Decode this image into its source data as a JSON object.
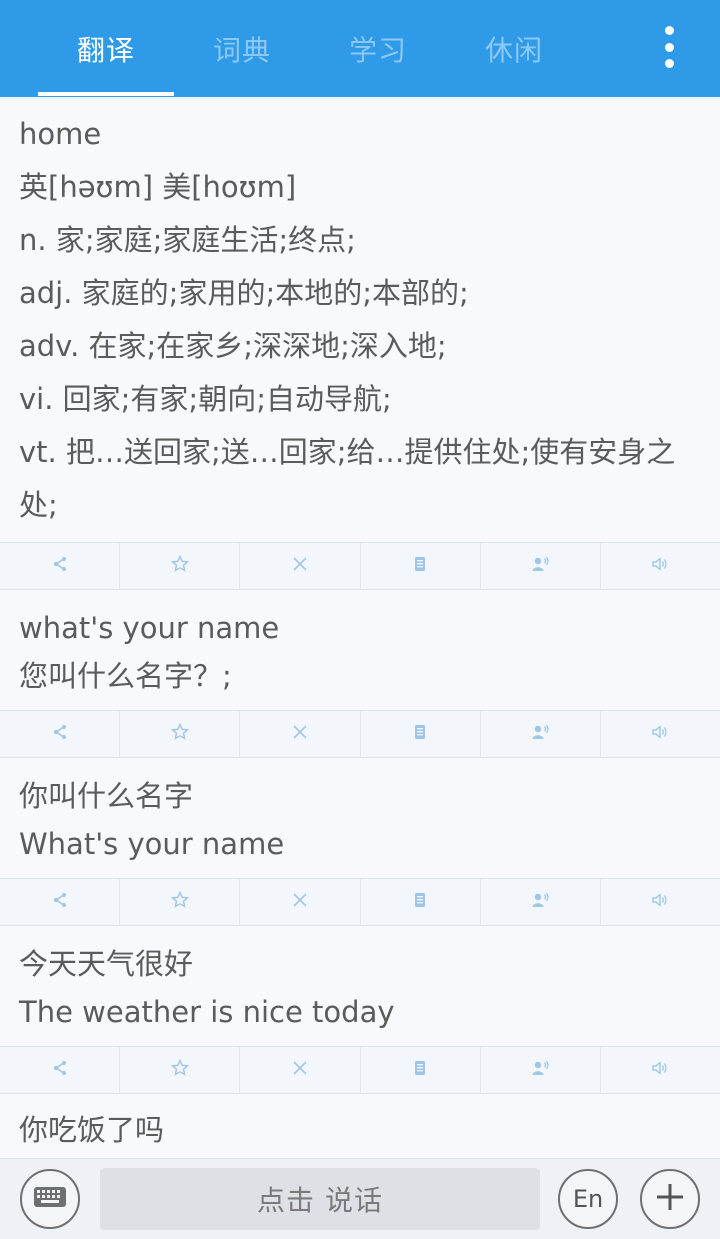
{
  "tabs": {
    "translate": "翻译",
    "dictionary": "词典",
    "study": "学习",
    "leisure": "休闲"
  },
  "entries": [
    {
      "lines": [
        "home",
        "英[həʊm]    美[hoʊm]",
        "n. 家;家庭;家庭生活;终点;",
        "adj. 家庭的;家用的;本地的;本部的;",
        "adv. 在家;在家乡;深深地;深入地;",
        "vi. 回家;有家;朝向;自动导航;",
        "vt. 把…送回家;送…回家;给…提供住处;使有安身之处;"
      ]
    },
    {
      "lines": [
        "what's your name",
        "您叫什么名字？;"
      ]
    },
    {
      "lines": [
        "你叫什么名字",
        "What's your name"
      ]
    },
    {
      "lines": [
        "今天天气很好",
        "The weather is nice today"
      ]
    },
    {
      "lines": [
        "你吃饭了吗"
      ]
    }
  ],
  "action_icons": [
    "share-icon",
    "star-icon",
    "close-icon",
    "copy-icon",
    "speaker-person-icon",
    "volume-icon"
  ],
  "bottom": {
    "speak_label": "点击 说话",
    "lang_label": "En"
  },
  "colors": {
    "accent": "#2f9be8",
    "icon": "#9fc6ea"
  }
}
